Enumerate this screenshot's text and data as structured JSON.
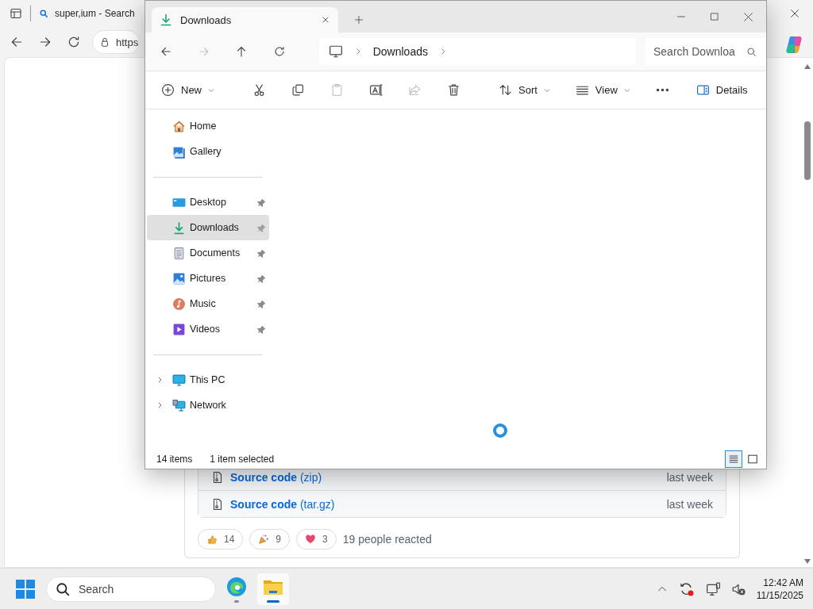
{
  "browser": {
    "tab": {
      "title": "super,ium - Search"
    },
    "address": {
      "value": "https"
    },
    "release": {
      "assets": [
        {
          "name": "**Source code** (zip)",
          "time": "last week"
        },
        {
          "name": "**Source code** (tar.gz)",
          "time": "last week"
        }
      ],
      "reactions": [
        {
          "kind": "thumbs-up",
          "count": "14"
        },
        {
          "kind": "party",
          "count": "9"
        },
        {
          "kind": "heart",
          "count": "3"
        }
      ],
      "reaction_summary": "19 people reacted"
    }
  },
  "explorer": {
    "tabs": [
      {
        "title": "Downloads",
        "selected": true
      }
    ],
    "nav": [
      {
        "kind": "back",
        "disabled": false
      },
      {
        "kind": "forward",
        "disabled": true
      },
      {
        "kind": "up",
        "disabled": false
      },
      {
        "kind": "refresh",
        "disabled": false
      }
    ],
    "breadcrumb": [
      "Downloads"
    ],
    "search": {
      "placeholder": "Search Downloa"
    },
    "toolbar": [
      {
        "kind": "new",
        "label": "New",
        "dropdown": true,
        "disabled": false
      },
      {
        "kind": "cut",
        "disabled": false
      },
      {
        "kind": "copy",
        "disabled": false
      },
      {
        "kind": "paste",
        "disabled": true
      },
      {
        "kind": "rename",
        "disabled": false
      },
      {
        "kind": "share",
        "disabled": true
      },
      {
        "kind": "delete",
        "disabled": false
      },
      {
        "kind": "sort",
        "label": "Sort",
        "dropdown": true,
        "disabled": false
      },
      {
        "kind": "view",
        "label": "View",
        "dropdown": true,
        "disabled": false
      },
      {
        "kind": "more",
        "disabled": false
      }
    ],
    "details_button": {
      "label": "Details"
    },
    "sidebar": {
      "sections": [
        [
          {
            "kind": "home",
            "label": "Home",
            "selected": false
          },
          {
            "kind": "gallery",
            "label": "Gallery",
            "selected": false
          }
        ],
        [
          {
            "kind": "desktop",
            "label": "Desktop",
            "pinned": true,
            "selected": false
          },
          {
            "kind": "downloads",
            "label": "Downloads",
            "pinned": true,
            "selected": true
          },
          {
            "kind": "documents",
            "label": "Documents",
            "pinned": true,
            "selected": false
          },
          {
            "kind": "pictures",
            "label": "Pictures",
            "pinned": true,
            "selected": false
          },
          {
            "kind": "music",
            "label": "Music",
            "pinned": true,
            "selected": false
          },
          {
            "kind": "videos",
            "label": "Videos",
            "pinned": true,
            "selected": false
          }
        ],
        [
          {
            "kind": "pc",
            "label": "This PC",
            "expanded": false,
            "selected": false
          },
          {
            "kind": "network",
            "label": "Network",
            "expanded": false,
            "selected": false
          }
        ]
      ]
    },
    "status": {
      "count": "14 items",
      "selection": "1 item selected"
    },
    "view_modes": [
      {
        "kind": "details",
        "selected": true
      },
      {
        "kind": "tiles",
        "selected": false
      }
    ]
  },
  "taskbar": {
    "search": {
      "placeholder": "Search"
    },
    "apps": [
      {
        "kind": "edge",
        "active": false
      },
      {
        "kind": "explorer",
        "active": true
      }
    ],
    "clock": {
      "time": "12:42 AM",
      "date": "11/15/2025"
    }
  }
}
